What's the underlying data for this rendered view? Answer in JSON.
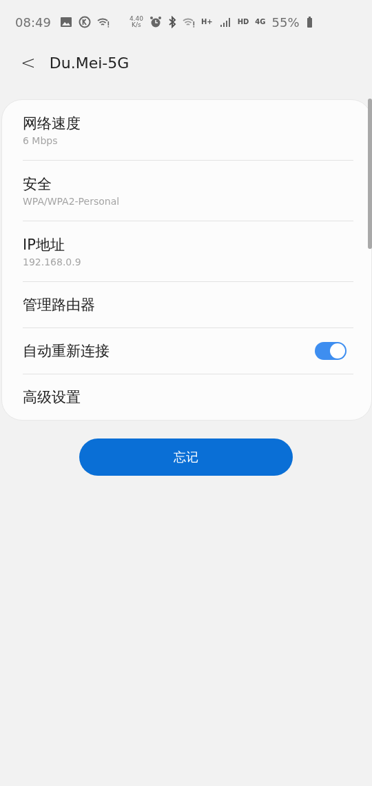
{
  "status_bar": {
    "time": "08:49",
    "speed": "4.40",
    "speed_unit": "K/s",
    "hplus": "H+",
    "hd": "HD",
    "network": "4G",
    "battery": "55%"
  },
  "header": {
    "back": "<",
    "title": "Du.Mei-5G"
  },
  "settings": [
    {
      "kind": "detail",
      "title": "网络速度",
      "value": "6  Mbps"
    },
    {
      "kind": "detail",
      "title": "安全",
      "value": "WPA/WPA2-Personal"
    },
    {
      "kind": "detail",
      "title": "IP地址",
      "value": "192.168.0.9"
    },
    {
      "kind": "plain",
      "title": "管理路由器"
    },
    {
      "kind": "toggle",
      "title": "自动重新连接",
      "on": true
    },
    {
      "kind": "plain",
      "title": "高级设置"
    }
  ],
  "forget_button": "忘记"
}
